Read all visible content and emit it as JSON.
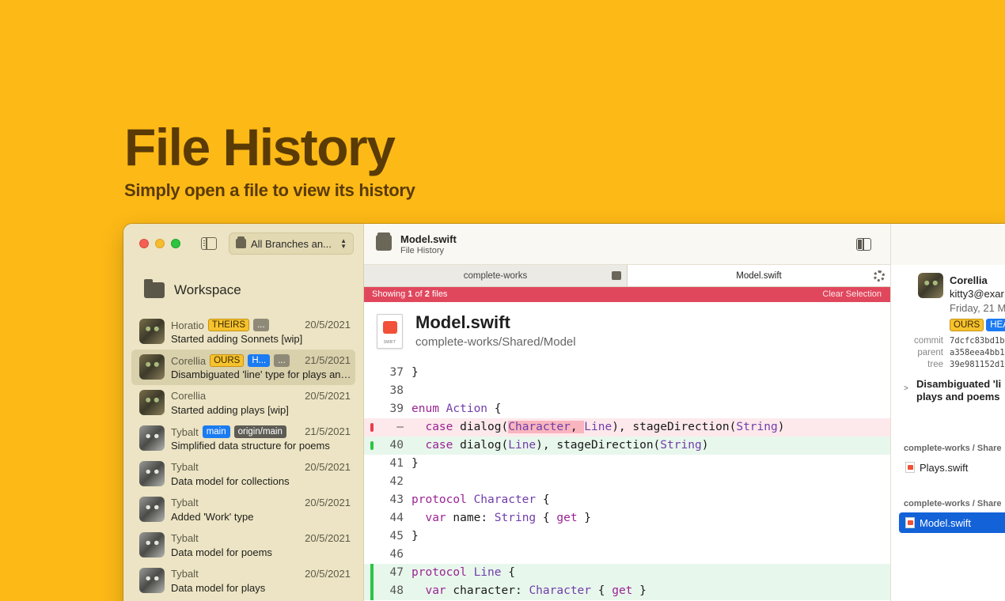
{
  "hero": {
    "title": "File History",
    "subtitle": "Simply open a file to view its history"
  },
  "sidebar": {
    "branch_selector": "All Branches an...",
    "workspace_label": "Workspace",
    "commits": [
      {
        "author": "Horatio",
        "date": "20/5/2021",
        "message": "Started adding Sonnets [wip]",
        "tags": [
          "THEIRS",
          "..."
        ],
        "avatar": "green"
      },
      {
        "author": "Corellia",
        "date": "21/5/2021",
        "message": "Disambiguated 'line' type for plays and poems",
        "tags": [
          "OURS",
          "H...",
          "..."
        ],
        "avatar": "green",
        "selected": true
      },
      {
        "author": "Corellia",
        "date": "20/5/2021",
        "message": "Started adding plays [wip]",
        "tags": [],
        "avatar": "green"
      },
      {
        "author": "Tybalt",
        "date": "21/5/2021",
        "message": "Simplified data structure for poems",
        "tags": [
          "main",
          "origin/main"
        ],
        "avatar": "gray"
      },
      {
        "author": "Tybalt",
        "date": "20/5/2021",
        "message": "Data model for collections",
        "tags": [],
        "avatar": "gray"
      },
      {
        "author": "Tybalt",
        "date": "20/5/2021",
        "message": "Added 'Work' type",
        "tags": [],
        "avatar": "gray"
      },
      {
        "author": "Tybalt",
        "date": "20/5/2021",
        "message": "Data model for poems",
        "tags": [],
        "avatar": "gray"
      },
      {
        "author": "Tybalt",
        "date": "20/5/2021",
        "message": "Data model for plays",
        "tags": [],
        "avatar": "gray"
      }
    ]
  },
  "toolbar": {
    "title": "Model.swift",
    "subtitle": "File History"
  },
  "tabs": [
    {
      "label": "complete-works"
    },
    {
      "label": "Model.swift"
    }
  ],
  "banner": {
    "prefix": "Showing ",
    "current": "1",
    "middle": " of ",
    "total": "2",
    "suffix": " files",
    "clear": "Clear Selection"
  },
  "file_header": {
    "name": "Model.swift",
    "path": "complete-works/Shared/Model"
  },
  "code_lines": [
    {
      "num": "37",
      "text": "}"
    },
    {
      "num": "38",
      "text": ""
    },
    {
      "num": "39",
      "text": "enum Action {"
    },
    {
      "num": "–",
      "text": "  case dialog(Character, Line), stageDirection(String)",
      "kind": "del"
    },
    {
      "num": "40",
      "text": "  case dialog(Line), stageDirection(String)",
      "kind": "add"
    },
    {
      "num": "41",
      "text": "}"
    },
    {
      "num": "42",
      "text": ""
    },
    {
      "num": "43",
      "text": "protocol Character {"
    },
    {
      "num": "44",
      "text": "  var name: String { get }"
    },
    {
      "num": "45",
      "text": "}"
    },
    {
      "num": "46",
      "text": ""
    },
    {
      "num": "47",
      "text": "protocol Line {",
      "kind": "add2"
    },
    {
      "num": "48",
      "text": "  var character: Character { get }",
      "kind": "add2"
    }
  ],
  "inspector": {
    "author": "Corellia",
    "email": "kitty3@exar",
    "date": "Friday, 21 M",
    "tags": [
      "OURS",
      "HEA"
    ],
    "meta": [
      {
        "key": "commit",
        "value": "7dcfc83bd1b"
      },
      {
        "key": "parent",
        "value": "a358eea4bb1"
      },
      {
        "key": "tree",
        "value": "39e981152d1"
      }
    ],
    "message_line1": "Disambiguated 'li",
    "message_line2": "plays and poems",
    "groups": [
      {
        "header": "complete-works / Share",
        "file": "Plays.swift"
      },
      {
        "header": "complete-works / Share",
        "file": "Model.swift"
      }
    ]
  }
}
